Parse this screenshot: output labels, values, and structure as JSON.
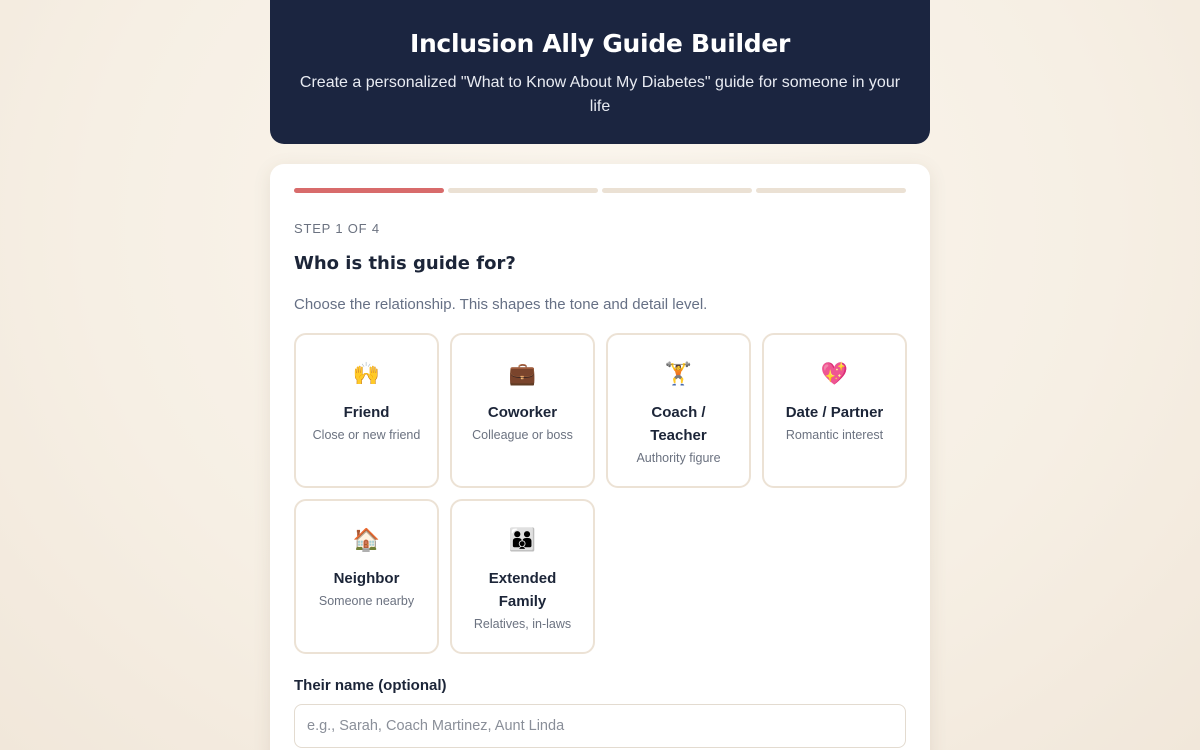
{
  "header": {
    "title": "Inclusion Ally Guide Builder",
    "subtitle": "Create a personalized \"What to Know About My Diabetes\" guide for someone in your life"
  },
  "progress": {
    "current_step": 1,
    "total_steps": 4
  },
  "step": {
    "label": "STEP 1 OF 4",
    "question": "Who is this guide for?",
    "hint": "Choose the relationship. This shapes the tone and detail level."
  },
  "options": [
    {
      "icon": "🙌",
      "icon_name": "raised-hands-icon",
      "title": "Friend",
      "sub": "Close or new friend"
    },
    {
      "icon": "💼",
      "icon_name": "briefcase-icon",
      "title": "Coworker",
      "sub": "Colleague or boss"
    },
    {
      "icon": "🏋️",
      "icon_name": "weightlifter-icon",
      "title": "Coach / Teacher",
      "sub": "Authority figure"
    },
    {
      "icon": "💖",
      "icon_name": "sparkling-heart-icon",
      "title": "Date / Partner",
      "sub": "Romantic interest"
    },
    {
      "icon": "🏠",
      "icon_name": "house-icon",
      "title": "Neighbor",
      "sub": "Someone nearby"
    },
    {
      "icon": "👪",
      "icon_name": "family-icon",
      "title": "Extended Family",
      "sub": "Relatives, in-laws"
    }
  ],
  "name_field": {
    "label": "Their name (optional)",
    "placeholder": "e.g., Sarah, Coach Martinez, Aunt Linda",
    "value": ""
  },
  "colors": {
    "header_bg": "#1b2540",
    "progress_active": "#d86b6b",
    "progress_inactive": "#ebe1d4",
    "card_border": "#ece2d5"
  }
}
